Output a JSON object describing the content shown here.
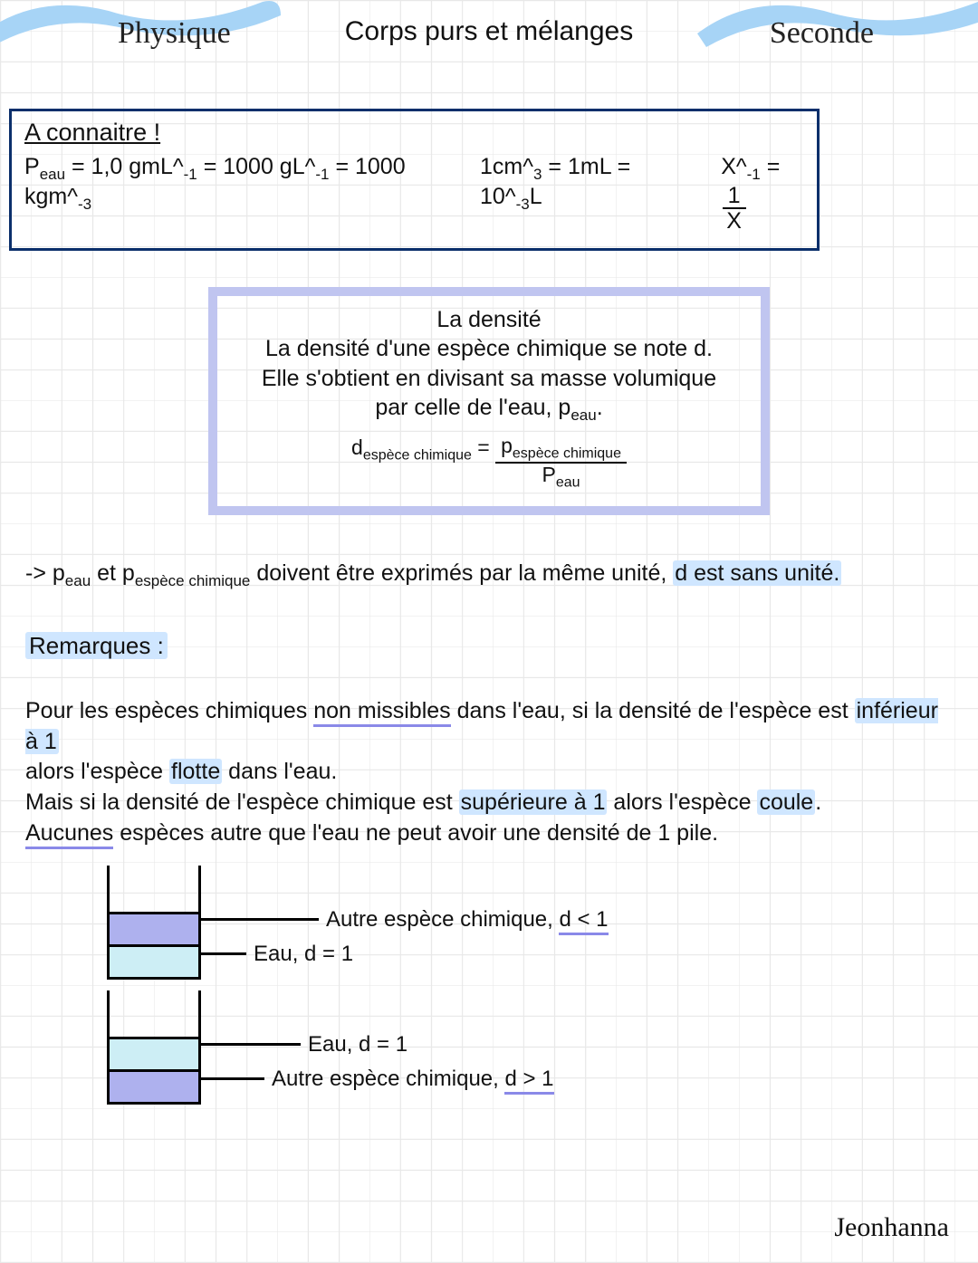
{
  "header": {
    "subject": "Physique",
    "title": "Corps purs et mélanges",
    "level": "Seconde"
  },
  "know_box": {
    "title": "A connaitre !",
    "rho_label": "P",
    "rho_sub": "eau",
    "eq": "= 1,0 gmL^",
    "exp1": "-1",
    "mid1": " = 1000 gL^",
    "mid2": " = 1000 kgm^",
    "exp3": "-3",
    "vol_prefix": "1cm^",
    "vol_exp": "3",
    "vol_rest": " = 1mL = 10^",
    "vol_exp2": "-3",
    "vol_tail": "L",
    "inv_lhs": "X^",
    "inv_exp": "-1",
    "inv_eq": " = ",
    "inv_num": "1",
    "inv_den": "X"
  },
  "callout": {
    "title": "La densité",
    "line1": "La densité d'une espèce chimique se note d.",
    "line2": "Elle s'obtient en divisant sa masse volumique",
    "line3": "par celle de l'eau, p",
    "line3_sub": "eau",
    "f_d": "d",
    "f_d_sub": "espèce chimique",
    "f_eq": " = ",
    "f_num_p": "p",
    "f_num_sub": "espèce chimique",
    "f_den_p": "P",
    "f_den_sub": "eau"
  },
  "note": {
    "arrow": "-> ",
    "p1a": "p",
    "p1a_sub": "eau",
    "and": " et ",
    "p1b": "p",
    "p1b_sub": "espèce chimique",
    "rest": " doivent être exprimés par la même unité, ",
    "hl": "d est sans unité."
  },
  "remarks_label": "Remarques :",
  "body": {
    "l1a": "Pour les espèces chimiques ",
    "l1_ul": "non missibles",
    "l1b": " dans l'eau, si la densité de l'espèce est ",
    "l1_hl": "inférieur à 1",
    "l2a": "alors l'espèce ",
    "l2_hl": "flotte",
    "l2b": " dans l'eau.",
    "l3a": "Mais si la densité de l'espèce chimique est ",
    "l3_hl": "supérieure à 1",
    "l3b": " alors l'espèce ",
    "l3_hl2": "coule",
    "l3c": ".",
    "l4_ul": "Aucunes",
    "l4b": " espèces autre que l'eau ne peut avoir une densité de 1 pile."
  },
  "beakers": {
    "b1_top_label": "Autre espèce chimique, ",
    "b1_top_ul": "d < 1",
    "b1_bot_label": "Eau, d = 1",
    "b2_top_label": "Eau, d = 1",
    "b2_bot_label": "Autre espèce chimique, ",
    "b2_bot_ul": "d > 1"
  },
  "author": "Jeonhanna"
}
